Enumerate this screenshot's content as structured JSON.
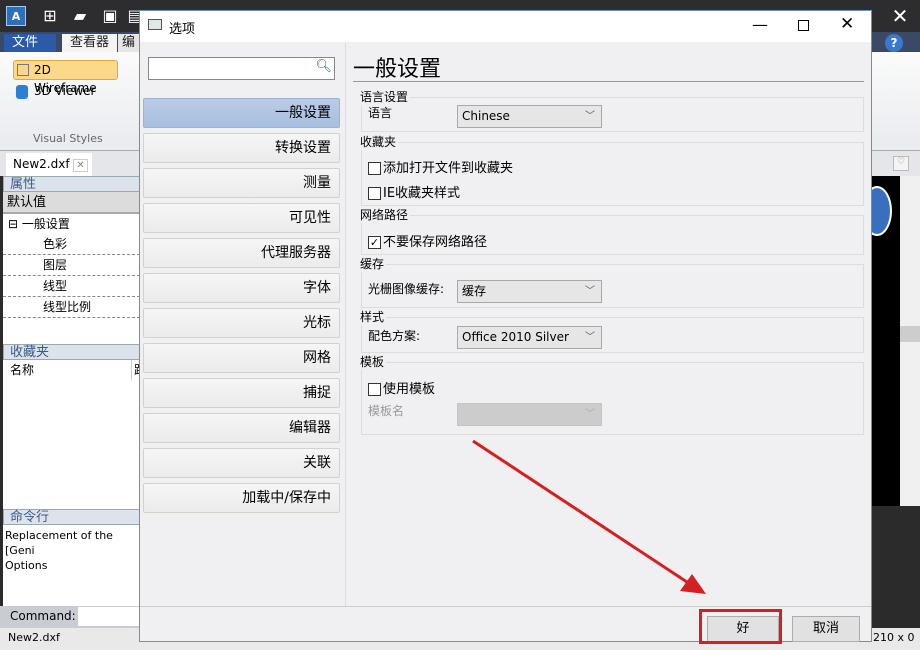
{
  "app": {
    "ribbon_tabs": [
      "文件",
      "查看器",
      "编"
    ],
    "ribbon": {
      "wireframe": "2D Wireframe",
      "viewer3d": "3D Viewer",
      "group_label": "Visual Styles"
    },
    "doc_tab": "New2.dxf",
    "properties": {
      "title": "属性",
      "header": "默认值",
      "root": "一般设置",
      "items": [
        "色彩",
        "图层",
        "线型",
        "线型比例"
      ]
    },
    "favorites": {
      "title": "收藏夹",
      "col_name": "名称",
      "col_path": "路"
    },
    "command": {
      "title": "命令行",
      "log": [
        "Replacement of the [Geni",
        "Options"
      ],
      "label": "Command:"
    },
    "status": {
      "file": "New2.dxf",
      "coords": "210 x 0"
    }
  },
  "dialog": {
    "title": "选项",
    "search_placeholder": "",
    "nav": [
      "一般设置",
      "转换设置",
      "测量",
      "可见性",
      "代理服务器",
      "字体",
      "光标",
      "网格",
      "捕捉",
      "编辑器",
      "关联",
      "加载中/保存中"
    ],
    "active_nav": 0,
    "heading": "一般设置",
    "groups": {
      "language": {
        "title": "语言设置",
        "label": "语言",
        "value": "Chinese"
      },
      "favorites": {
        "title": "收藏夹",
        "opt1": "添加打开文件到收藏夹",
        "opt1_checked": false,
        "opt2": "IE收藏夹样式",
        "opt2_checked": false
      },
      "network": {
        "title": "网络路径",
        "opt1": "不要保存网络路径",
        "opt1_checked": true
      },
      "cache": {
        "title": "缓存",
        "label": "光栅图像缓存:",
        "value": "缓存"
      },
      "style": {
        "title": "样式",
        "label": "配色方案:",
        "value": "Office 2010 Silver"
      },
      "template": {
        "title": "模板",
        "opt1": "使用模板",
        "opt1_checked": false,
        "label": "模板名",
        "value": ""
      }
    },
    "ok": "好",
    "cancel": "取消"
  },
  "annotation_color": "#d42020"
}
